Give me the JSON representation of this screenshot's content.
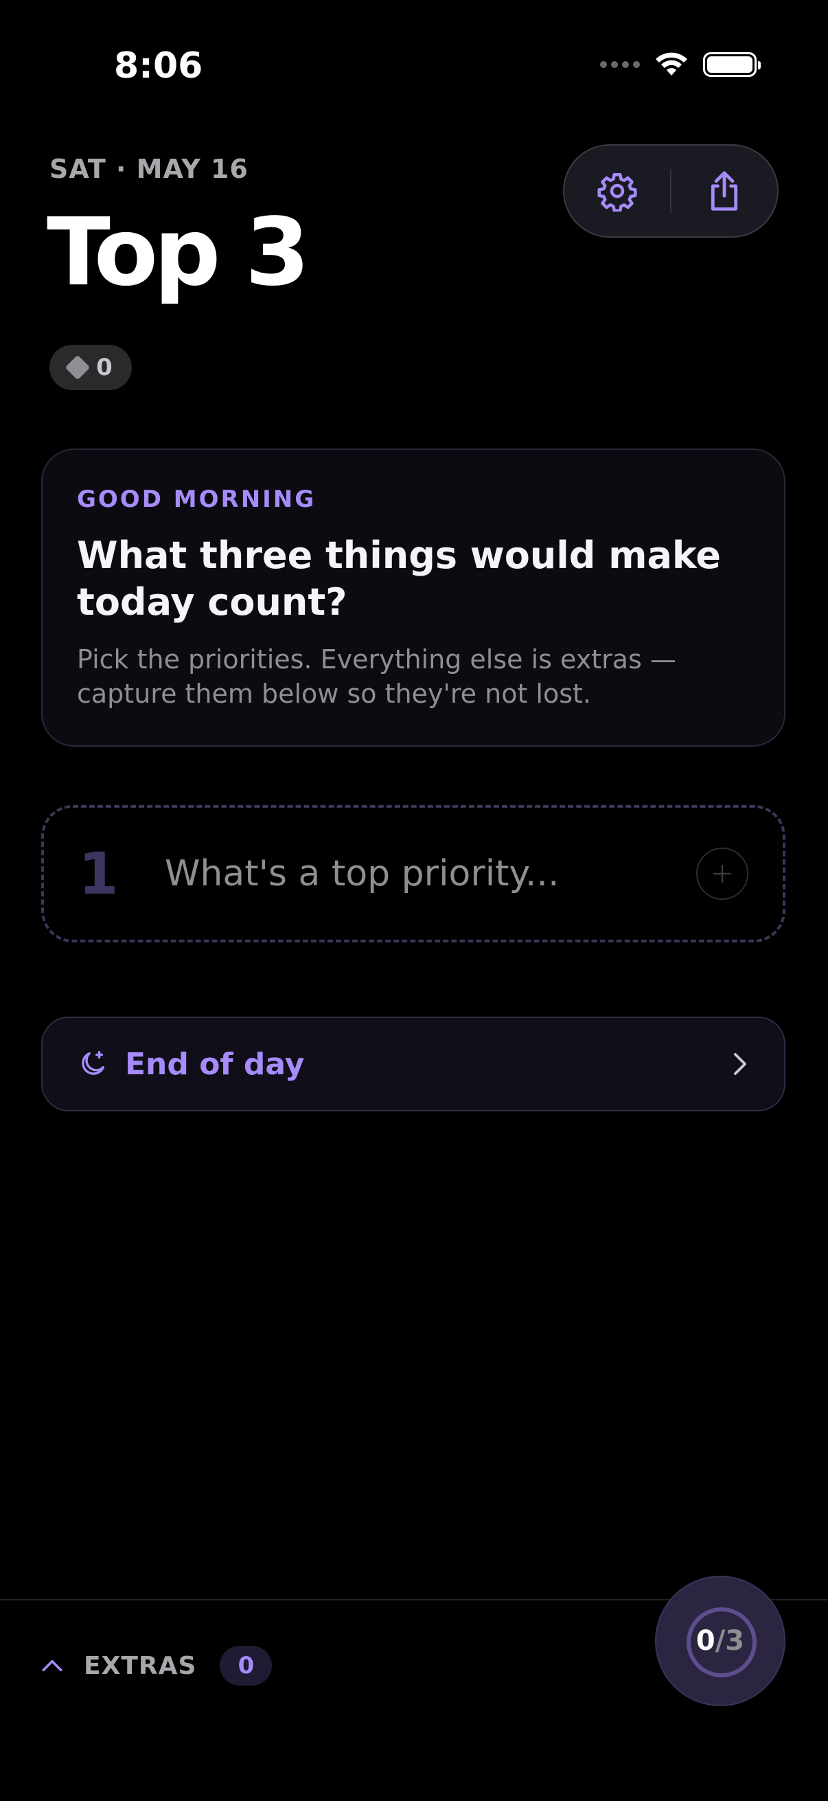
{
  "status_bar": {
    "time": "8:06"
  },
  "header": {
    "date": "SAT · MAY 16",
    "title": "Top 3",
    "gems_count": "0",
    "actions": {
      "settings_icon": "gear-icon",
      "share_icon": "share-icon"
    }
  },
  "greeting": {
    "eyebrow": "GOOD MORNING",
    "heading": "What three things would make today count?",
    "subtext": "Pick the priorities. Everything else is extras — capture them below so they're not lost."
  },
  "priority_input": {
    "number": "1",
    "placeholder": "What's a top priority..."
  },
  "end_of_day": {
    "label": "End of day",
    "icon": "moon-sparkle-icon"
  },
  "extras": {
    "label": "EXTRAS",
    "count": "0"
  },
  "progress": {
    "done": "0",
    "total": "/3",
    "fraction": 0
  },
  "colors": {
    "accent": "#a78bfa",
    "background": "#000000",
    "card": "#0c0b12",
    "muted": "#8e8e93"
  }
}
